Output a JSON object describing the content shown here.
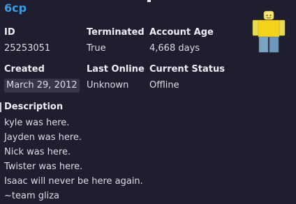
{
  "profile": {
    "username": "6cp",
    "id_label": "ID",
    "id_value": "25253051",
    "terminated_label": "Terminated",
    "terminated_value": "True",
    "account_age_label": "Account Age",
    "account_age_value": "4,668 days",
    "created_label": "Created",
    "created_value": "March 29, 2012",
    "last_online_label": "Last Online",
    "last_online_value": "Unknown",
    "current_status_label": "Current Status",
    "current_status_value": "Offline",
    "description_label": "Description",
    "description_lines": [
      "kyle was here.",
      "Jayden was here.",
      "Nick was here.",
      "Twister was here.",
      "Isaac will never be here again.",
      "~team gliza"
    ]
  },
  "colors": {
    "background": "#1f1e2f",
    "username": "#3d9be0",
    "chip": "#36364a"
  },
  "icons": {
    "avatar": "roblox-avatar-icon"
  }
}
